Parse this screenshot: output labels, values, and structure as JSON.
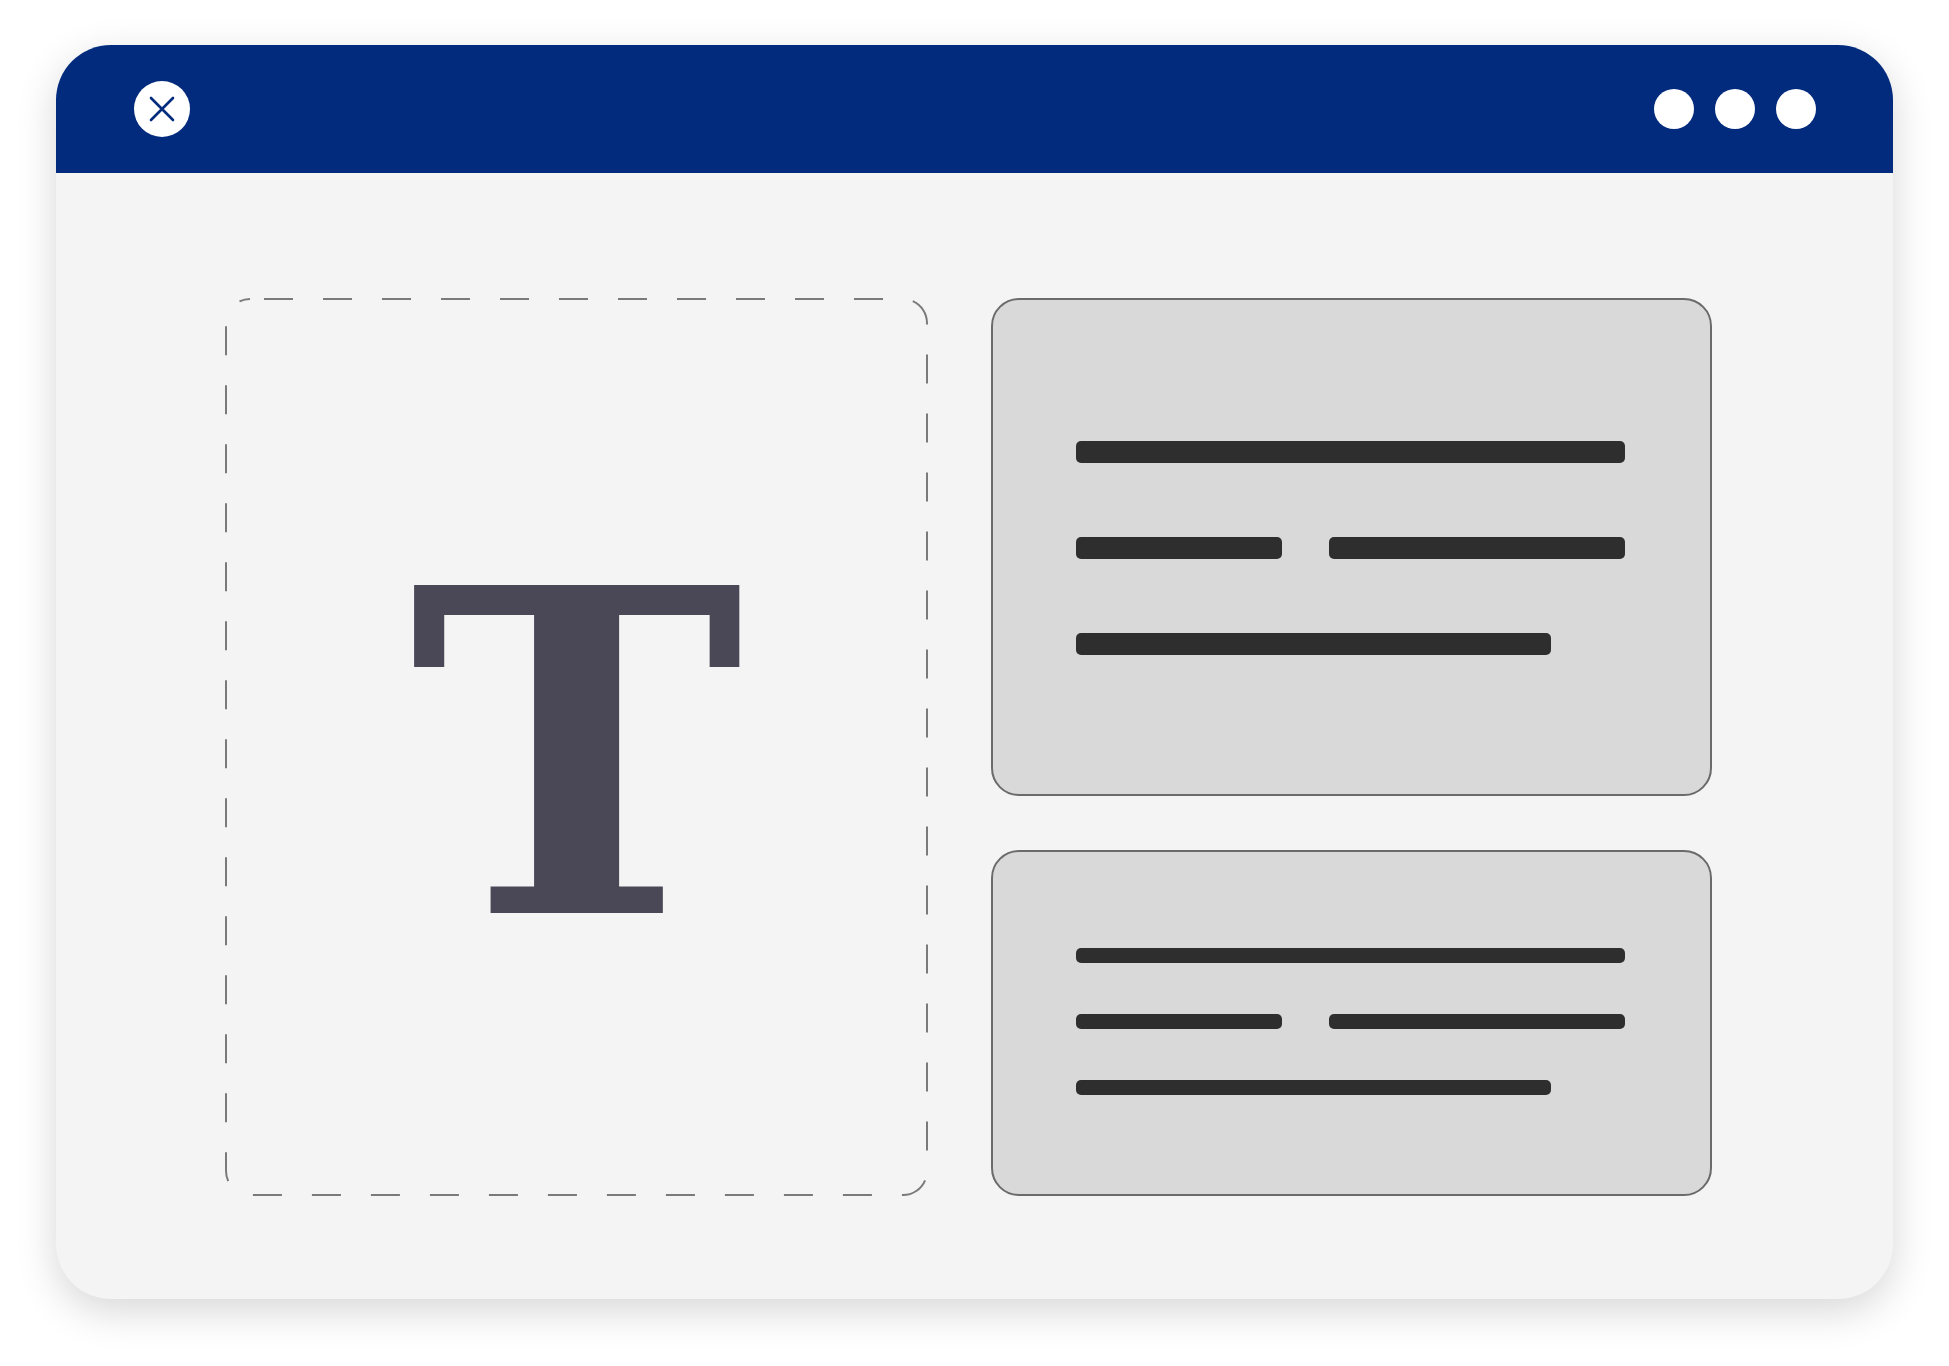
{
  "canvas": {
    "text_glyph": "T"
  }
}
